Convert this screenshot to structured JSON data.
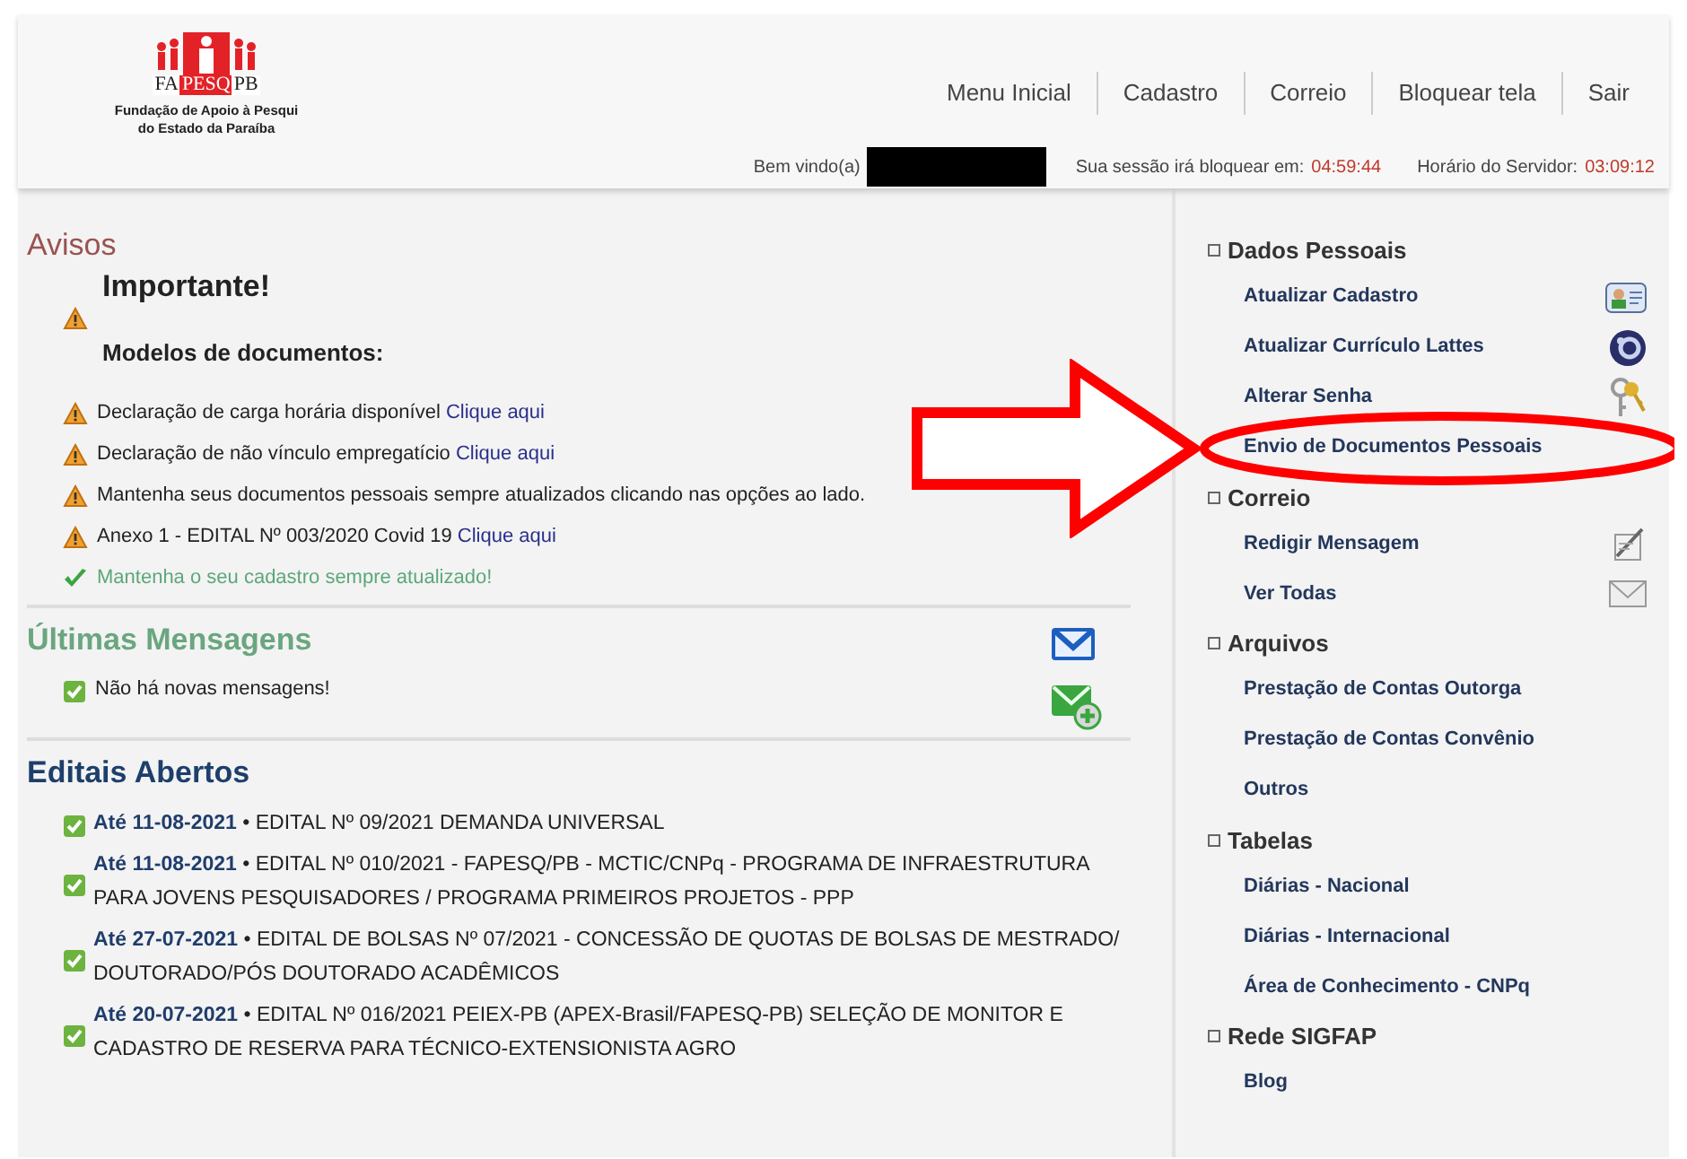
{
  "logo": {
    "parts": [
      "FA",
      "PESQ",
      "PB"
    ],
    "caption": [
      "Fundação de Apoio à Pesqui",
      "do Estado da Paraíba"
    ]
  },
  "nav": [
    "Menu Inicial",
    "Cadastro",
    "Correio",
    "Bloquear tela",
    "Sair"
  ],
  "status": {
    "welcome": "Bem vindo(a)",
    "name_hidden": true,
    "session_label": "Sua sessão irá bloquear em:",
    "session_time": "04:59:44",
    "server_label": "Horário do Servidor:",
    "server_time": "03:09:12"
  },
  "avisos": {
    "title": "Avisos",
    "important": "Importante!",
    "subtitle": "Modelos de documentos:",
    "items": [
      {
        "kind": "warning",
        "text": "Declaração de carga horária disponível",
        "link": "Clique aqui"
      },
      {
        "kind": "warning",
        "text": "Declaração de não vínculo empregatício",
        "link": "Clique aqui"
      },
      {
        "kind": "warning",
        "text": "Mantenha seus documentos pessoais sempre atualizados clicando nas opções ao lado."
      },
      {
        "kind": "warning",
        "text": "Anexo 1 - EDITAL Nº 003/2020 Covid 19",
        "link": "Clique aqui"
      },
      {
        "kind": "ok",
        "text": "Mantenha o seu cadastro sempre atualizado!"
      }
    ]
  },
  "mensagens": {
    "title": "Últimas Mensagens",
    "items": [
      "Não há novas mensagens!"
    ]
  },
  "editais": {
    "title": "Editais Abertos",
    "items": [
      "**Até 11-08-2021** • EDITAL Nº 09/2021 DEMANDA UNIVERSAL",
      "**Até 11-08-2021** • EDITAL Nº 010/2021 - FAPESQ/PB - MCTIC/CNPq - PROGRAMA DE INFRAESTRUTURA PARA JOVENS PESQUISADORES / PROGRAMA PRIMEIROS PROJETOS - PPP",
      "**Até 27-07-2021** • EDITAL DE BOLSAS Nº 07/2021 - CONCESSÃO DE QUOTAS DE BOLSAS DE MESTRADO/ DOUTORADO/PÓS DOUTORADO ACADÊMICOS",
      "**Até 20-07-2021** • EDITAL Nº 016/2021 PEIEX-PB (APEX-Brasil/FAPESQ-PB) SELEÇÃO DE MONITOR E CADASTRO DE RESERVA PARA TÉCNICO-EXTENSIONISTA AGRO"
    ]
  },
  "sidebar": [
    {
      "title": "Dados Pessoais",
      "items": [
        {
          "label": "Atualizar Cadastro"
        },
        {
          "label": "Atualizar Currículo Lattes"
        },
        {
          "label": "Alterar Senha"
        },
        {
          "label": "Envio de Documentos Pessoais"
        }
      ]
    },
    {
      "title": "Correio",
      "items": [
        {
          "label": "Redigir Mensagem"
        },
        {
          "label": "Ver Todas"
        }
      ]
    },
    {
      "title": "Arquivos",
      "items": [
        {
          "label": "Prestação de Contas Outorga"
        },
        {
          "label": "Prestação de Contas Convênio"
        },
        {
          "label": "Outros"
        }
      ]
    },
    {
      "title": "Tabelas",
      "items": [
        {
          "label": "Diárias - Nacional"
        },
        {
          "label": "Diárias - Internacional"
        },
        {
          "label": "Área de Conhecimento - CNPq"
        }
      ]
    },
    {
      "title": "Rede SIGFAP",
      "items": [
        {
          "label": "Blog"
        }
      ]
    }
  ],
  "arrow": {
    "color": "#ff0000"
  },
  "highlight_ring": {
    "color": "#ff0000"
  }
}
